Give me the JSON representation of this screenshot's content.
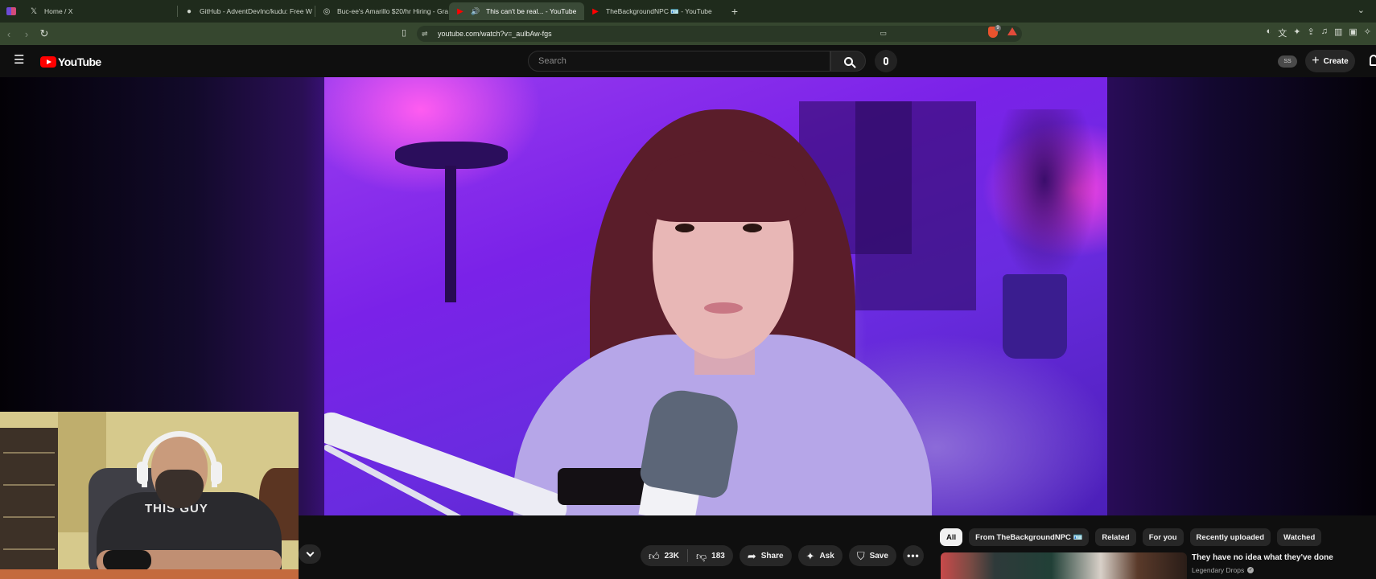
{
  "browser": {
    "tabs": [
      {
        "title": "Home / X",
        "icon": "x-logo-icon",
        "active": false
      },
      {
        "title": "GitHub - AdventDevInc/kudu: Free W",
        "icon": "github-icon",
        "active": false
      },
      {
        "title": "Buc-ee's Amarillo $20/hr Hiring - Gra",
        "icon": "globe-icon",
        "active": false
      },
      {
        "title": "This can't be real... - YouTube",
        "icon": "youtube-icon",
        "active": true
      },
      {
        "title": "TheBackgroundNPC 🪪 - YouTube",
        "icon": "youtube-icon",
        "active": false
      }
    ],
    "url": "youtube.com/watch?v=_aulbAw-fgs"
  },
  "youtube": {
    "logo_text": "YouTube",
    "search_placeholder": "Search",
    "avatar_badge": "SS",
    "create_label": "Create",
    "colors": {
      "brand_red": "#ff0000",
      "background": "#0f0f0f"
    }
  },
  "video": {
    "webcam_shirt_text": "THIS GUY"
  },
  "actions": {
    "likes": "23K",
    "dislikes": "183",
    "share": "Share",
    "ask": "Ask",
    "save": "Save"
  },
  "chips": [
    "All",
    "From TheBackgroundNPC 🪪",
    "Related",
    "For you",
    "Recently uploaded",
    "Watched"
  ],
  "recommendation": {
    "title": "They have no idea what they've done",
    "channel": "Legendary Drops"
  }
}
